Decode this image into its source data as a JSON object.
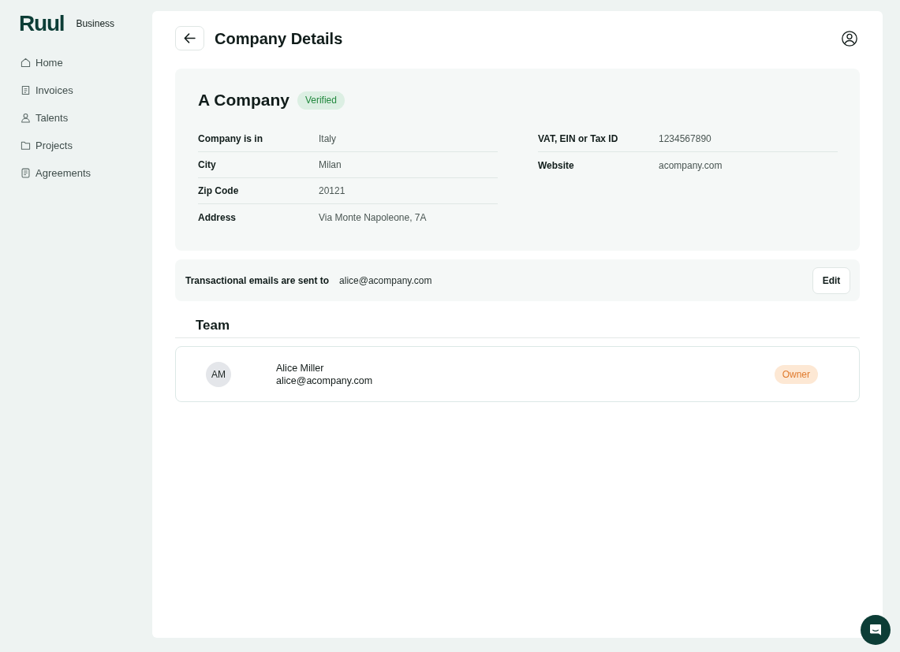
{
  "sidebar": {
    "logo": "Ruul",
    "product": "Business",
    "items": [
      {
        "label": "Home",
        "selected": false
      },
      {
        "label": "Invoices",
        "selected": false
      },
      {
        "label": "Talents",
        "selected": false
      },
      {
        "label": "Projects",
        "selected": false
      },
      {
        "label": "Agreements",
        "selected": false
      }
    ]
  },
  "header": {
    "title": "Company Details"
  },
  "company": {
    "name": "A Company",
    "badge": "Verified",
    "details_left": [
      {
        "label": "Company is in",
        "value": "Italy"
      },
      {
        "label": "City",
        "value": "Milan"
      },
      {
        "label": "Zip Code",
        "value": "20121"
      },
      {
        "label": "Address",
        "value": "Via Monte Napoleone, 7A"
      }
    ],
    "details_right": [
      {
        "label": "VAT, EIN or Tax ID",
        "value": "1234567890"
      },
      {
        "label": "Website",
        "value": "acompany.com"
      }
    ]
  },
  "notifications": {
    "label": "Transactional emails are sent to",
    "email": "alice@acompany.com",
    "button": "Edit"
  },
  "team": {
    "title": "Team",
    "members": [
      {
        "initials": "AM",
        "name": "Alice Miller",
        "email": "alice@acompany.com",
        "role": "Owner"
      }
    ]
  }
}
